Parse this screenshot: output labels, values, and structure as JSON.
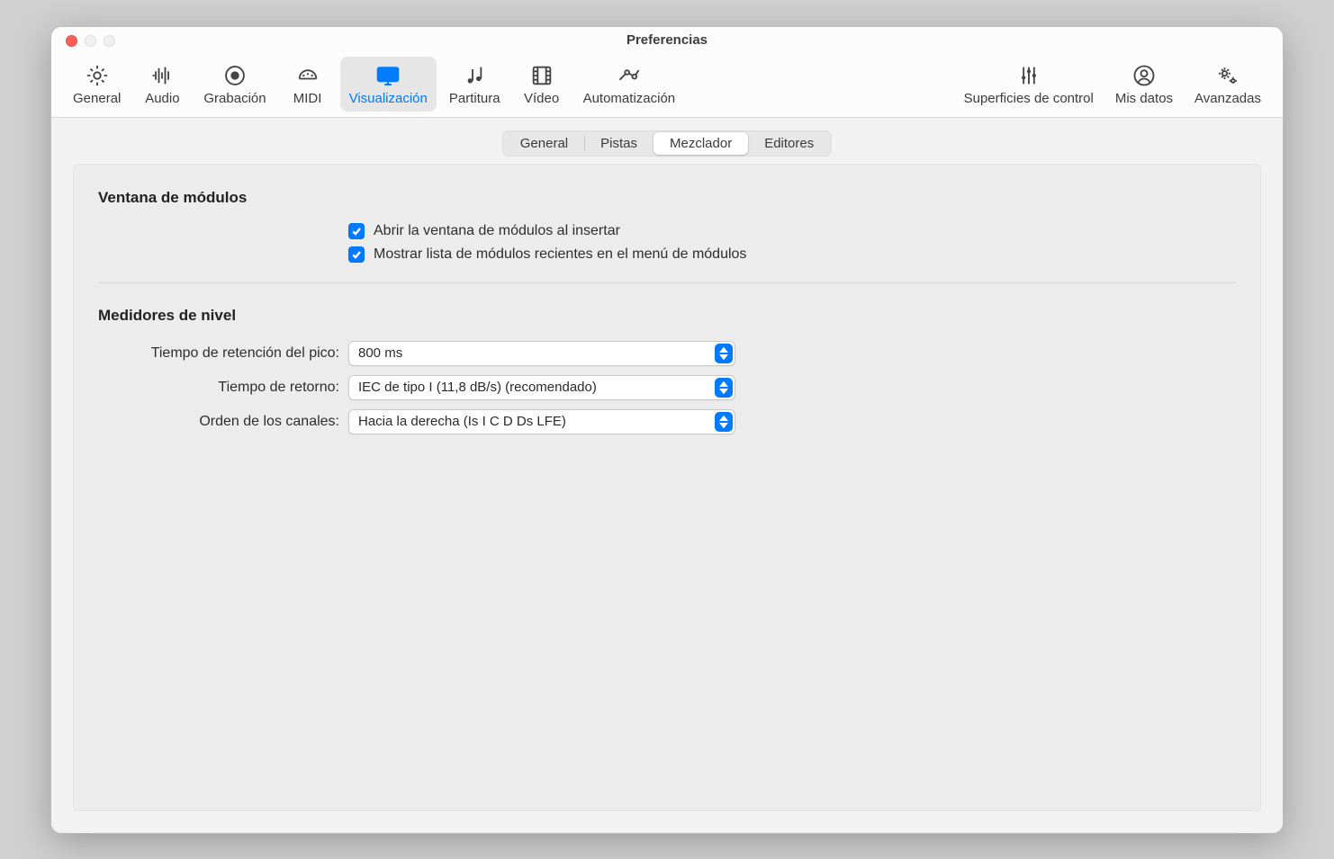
{
  "window": {
    "title": "Preferencias"
  },
  "toolbar": {
    "items": [
      {
        "id": "general",
        "label": "General"
      },
      {
        "id": "audio",
        "label": "Audio"
      },
      {
        "id": "grabacion",
        "label": "Grabación"
      },
      {
        "id": "midi",
        "label": "MIDI"
      },
      {
        "id": "visualizacion",
        "label": "Visualización",
        "selected": true
      },
      {
        "id": "partitura",
        "label": "Partitura"
      },
      {
        "id": "video",
        "label": "Vídeo"
      },
      {
        "id": "automatizacion",
        "label": "Automatización"
      },
      {
        "id": "superficies",
        "label": "Superficies de control"
      },
      {
        "id": "mis-datos",
        "label": "Mis datos"
      },
      {
        "id": "avanzadas",
        "label": "Avanzadas"
      }
    ]
  },
  "tabs": {
    "items": [
      "General",
      "Pistas",
      "Mezclador",
      "Editores"
    ],
    "active_index": 2
  },
  "sections": {
    "modules": {
      "heading": "Ventana de módulos",
      "check1": {
        "label": "Abrir la ventana de módulos al insertar",
        "checked": true
      },
      "check2": {
        "label": "Mostrar lista de módulos recientes en el menú de módulos",
        "checked": true
      }
    },
    "meters": {
      "heading": "Medidores de nivel",
      "row1": {
        "label": "Tiempo de retención del pico:",
        "value": "800 ms"
      },
      "row2": {
        "label": "Tiempo de retorno:",
        "value": "IEC de tipo I (11,8 dB/s) (recomendado)"
      },
      "row3": {
        "label": "Orden de los canales:",
        "value": "Hacia la derecha (Is I C D Ds LFE)"
      }
    }
  }
}
